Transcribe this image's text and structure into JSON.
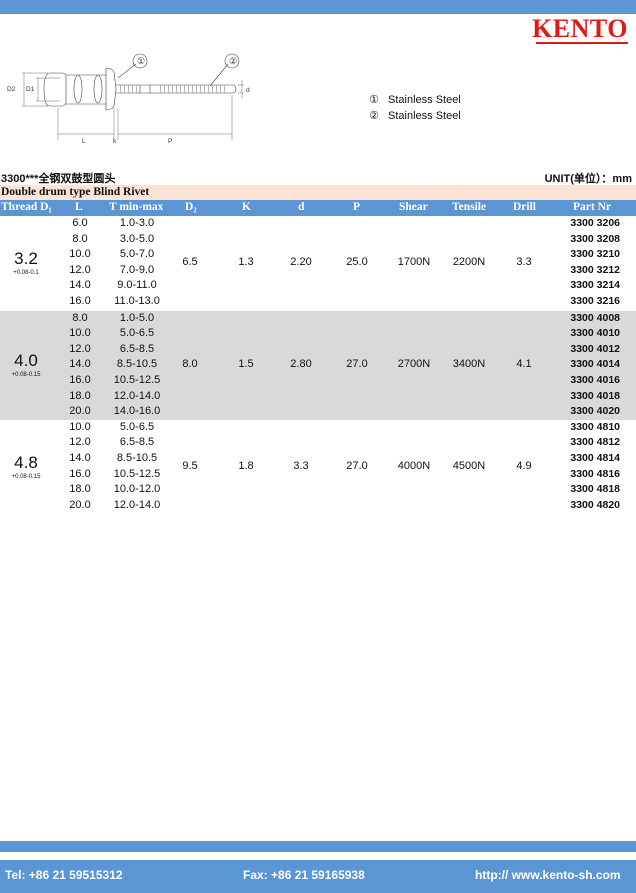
{
  "brand": {
    "logo_text": "KENTO"
  },
  "drawing": {
    "callouts": [
      "①",
      "②"
    ],
    "dim_labels": [
      "D2",
      "D1",
      "L",
      "k",
      "P",
      "d"
    ]
  },
  "materials": [
    {
      "num": "①",
      "label": "Stainless Steel"
    },
    {
      "num": "②",
      "label": "Stainless Steel"
    }
  ],
  "title_cn": "3300***全钢双鼓型圆头",
  "unit": "UNIT(单位）：mm",
  "subtitle": "Double drum type Blind Rivet",
  "headers": {
    "thread": "Thread D₁",
    "L": "L",
    "T": "T min-max",
    "D2": "D₂",
    "K": "K",
    "d": "d",
    "P": "P",
    "shear": "Shear",
    "tensile": "Tensile",
    "drill": "Drill",
    "part": "Part Nr"
  },
  "groups": [
    {
      "diameter": "3.2",
      "tolerance": "+0.08-0.1",
      "D2": "6.5",
      "K": "1.3",
      "d": "2.20",
      "P": "25.0",
      "shear": "1700N",
      "tensile": "2200N",
      "drill": "3.3",
      "rows": [
        {
          "L": "6.0",
          "T": "1.0-3.0",
          "part": "3300 3206"
        },
        {
          "L": "8.0",
          "T": "3.0-5.0",
          "part": "3300 3208"
        },
        {
          "L": "10.0",
          "T": "5.0-7.0",
          "part": "3300 3210"
        },
        {
          "L": "12.0",
          "T": "7.0-9.0",
          "part": "3300 3212"
        },
        {
          "L": "14.0",
          "T": "9.0-11.0",
          "part": "3300 3214"
        },
        {
          "L": "16.0",
          "T": "11.0-13.0",
          "part": "3300 3216"
        }
      ]
    },
    {
      "diameter": "4.0",
      "tolerance": "+0.08-0.15",
      "D2": "8.0",
      "K": "1.5",
      "d": "2.80",
      "P": "27.0",
      "shear": "2700N",
      "tensile": "3400N",
      "drill": "4.1",
      "rows": [
        {
          "L": "8.0",
          "T": "1.0-5.0",
          "part": "3300 4008"
        },
        {
          "L": "10.0",
          "T": "5.0-6.5",
          "part": "3300 4010"
        },
        {
          "L": "12.0",
          "T": "6.5-8.5",
          "part": "3300 4012"
        },
        {
          "L": "14.0",
          "T": "8.5-10.5",
          "part": "3300 4014"
        },
        {
          "L": "16.0",
          "T": "10.5-12.5",
          "part": "3300 4016"
        },
        {
          "L": "18.0",
          "T": "12.0-14.0",
          "part": "3300 4018"
        },
        {
          "L": "20.0",
          "T": "14.0-16.0",
          "part": "3300 4020"
        }
      ]
    },
    {
      "diameter": "4.8",
      "tolerance": "+0.08-0.15",
      "D2": "9.5",
      "K": "1.8",
      "d": "3.3",
      "P": "27.0",
      "shear": "4000N",
      "tensile": "4500N",
      "drill": "4.9",
      "rows": [
        {
          "L": "10.0",
          "T": "5.0-6.5",
          "part": "3300 4810"
        },
        {
          "L": "12.0",
          "T": "6.5-8.5",
          "part": "3300 4812"
        },
        {
          "L": "14.0",
          "T": "8.5-10.5",
          "part": "3300 4814"
        },
        {
          "L": "16.0",
          "T": "10.5-12.5",
          "part": "3300 4816"
        },
        {
          "L": "18.0",
          "T": "10.0-12.0",
          "part": "3300 4818"
        },
        {
          "L": "20.0",
          "T": "12.0-14.0",
          "part": "3300 4820"
        }
      ]
    }
  ],
  "footer": {
    "tel": "Tel: +86 21 59515312",
    "fax": "Fax: +86 21 59165938",
    "web": "http:// www.kento-sh.com"
  }
}
